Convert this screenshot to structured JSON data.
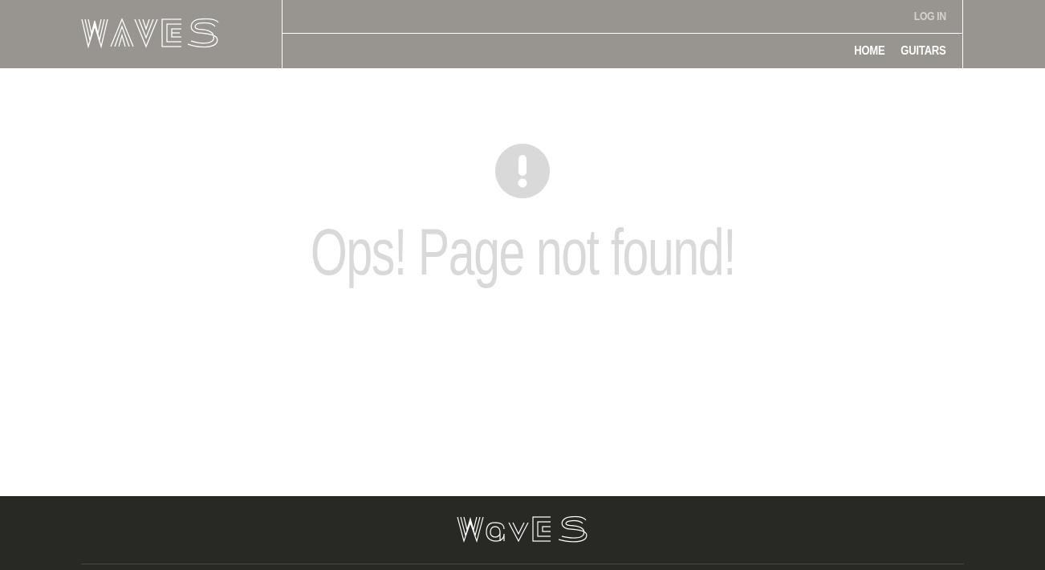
{
  "header": {
    "logo_text": "WAVES",
    "login_label": "LOG IN",
    "nav": [
      {
        "label": "HOME"
      },
      {
        "label": "GUITARS"
      }
    ],
    "background_color": "#98948f"
  },
  "main": {
    "alert_icon": "exclamation-circle-icon",
    "error_message": "Ops! Page not found!"
  },
  "footer": {
    "logo_text": "Waves",
    "background_color": "#282824"
  }
}
